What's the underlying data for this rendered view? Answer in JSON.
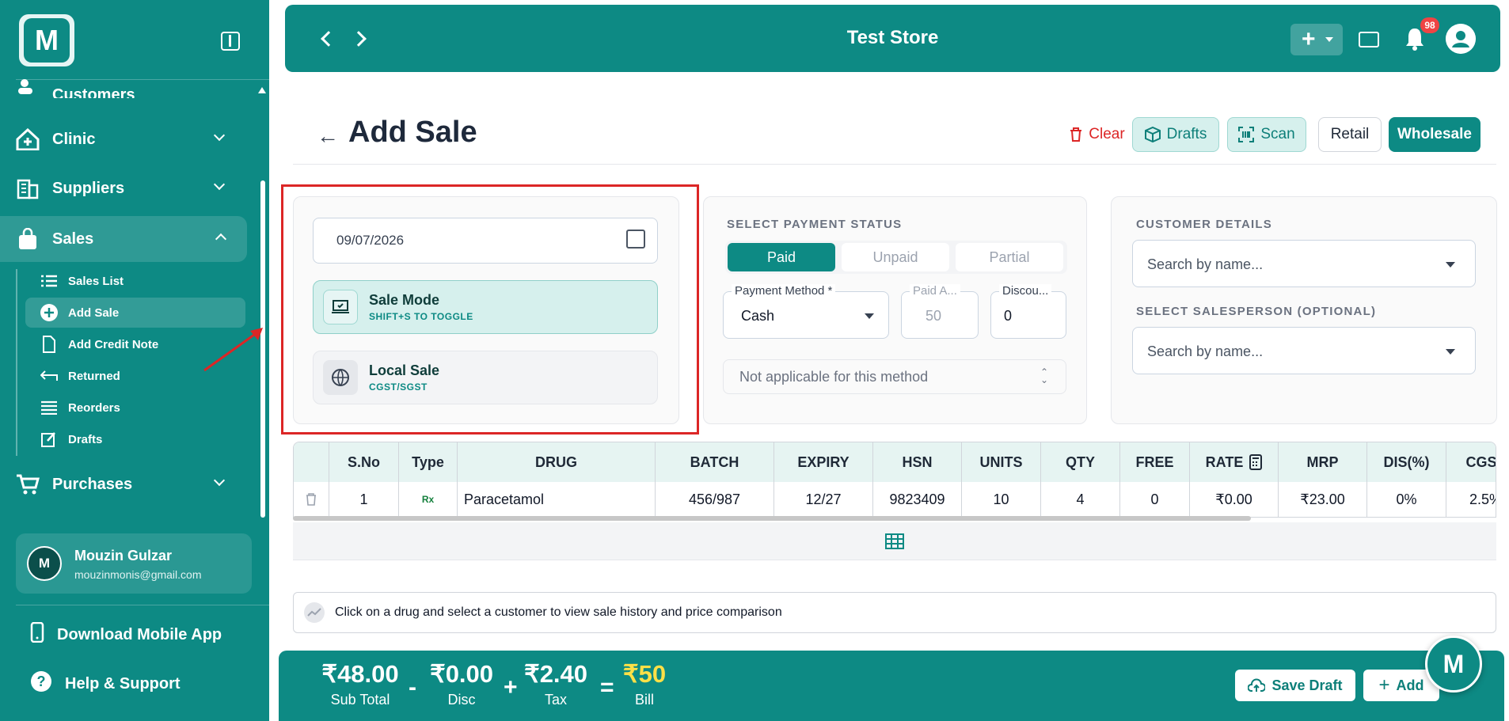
{
  "sidebar": {
    "logo_letter": "M",
    "nav": {
      "customers": "Customers",
      "clinic": "Clinic",
      "suppliers": "Suppliers",
      "sales": "Sales",
      "purchases": "Purchases"
    },
    "sub_items": [
      "Sales List",
      "Add Sale",
      "Add Credit Note",
      "Returned",
      "Reorders",
      "Drafts"
    ],
    "user": {
      "initial": "M",
      "name": "Mouzin Gulzar",
      "email": "mouzinmonis@gmail.com"
    },
    "download": "Download Mobile App",
    "help": "Help & Support"
  },
  "header": {
    "title": "Test Store",
    "notification_count": "98"
  },
  "page": {
    "title": "Add Sale",
    "buttons": {
      "clear": "Clear",
      "drafts": "Drafts",
      "scan": "Scan",
      "retail": "Retail",
      "wholesale": "Wholesale"
    }
  },
  "sale_panel": {
    "date": "09/07/2026",
    "sale_mode": {
      "title": "Sale Mode",
      "sub": "SHIFT+S TO TOGGLE"
    },
    "local_sale": {
      "title": "Local Sale",
      "sub": "CGST/SGST"
    }
  },
  "payment": {
    "section_label": "SELECT PAYMENT STATUS",
    "statuses": [
      "Paid",
      "Unpaid",
      "Partial"
    ],
    "selected_status": "Paid",
    "method_label": "Payment Method *",
    "method_value": "Cash",
    "paid_label": "Paid A...",
    "paid_value": "50",
    "discount_label": "Discou...",
    "discount_value": "0",
    "not_applicable": "Not applicable for this method"
  },
  "customer": {
    "details_label": "CUSTOMER DETAILS",
    "search_placeholder": "Search by name...",
    "salesperson_label": "SELECT SALESPERSON (OPTIONAL)",
    "salesperson_placeholder": "Search by name..."
  },
  "table": {
    "headers": [
      "S.No",
      "Type",
      "DRUG",
      "BATCH",
      "EXPIRY",
      "HSN",
      "UNITS",
      "QTY",
      "FREE",
      "RATE",
      "MRP",
      "DIS(%)",
      "CGST"
    ],
    "rows": [
      [
        "1",
        "Rx",
        "Paracetamol",
        "456/987",
        "12/27",
        "9823409",
        "10",
        "4",
        "0",
        "₹0.00",
        "₹23.00",
        "0%",
        "2.5%"
      ]
    ]
  },
  "info_text": "Click on a drug and select a customer to view sale history and price comparison",
  "footer": {
    "subtotal": "₹48.00",
    "subtotal_label": "Sub Total",
    "disc": "₹0.00",
    "disc_label": "Disc",
    "tax": "₹2.40",
    "tax_label": "Tax",
    "bill": "₹50",
    "bill_label": "Bill",
    "op_minus": "-",
    "op_plus": "+",
    "op_eq": "=",
    "save_draft": "Save Draft",
    "add": "Add"
  },
  "colors": {
    "primary": "#0d8a84",
    "danger": "#dc2626",
    "bill": "#fde047"
  }
}
